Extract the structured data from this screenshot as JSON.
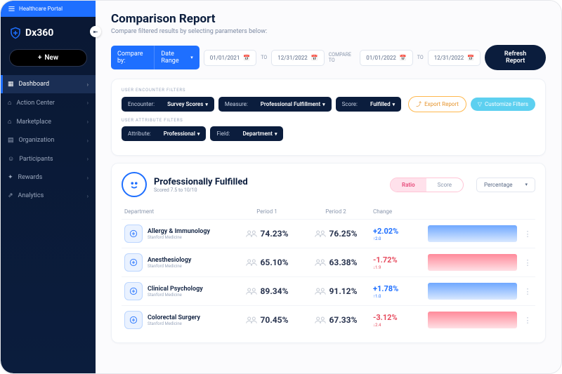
{
  "topBanner": "Healthcare Portal",
  "brand": "Dx360",
  "newBtn": "New",
  "nav": [
    {
      "icon": "grid",
      "label": "Dashboard",
      "active": true
    },
    {
      "icon": "bell",
      "label": "Action Center"
    },
    {
      "icon": "bag",
      "label": "Marketplace"
    },
    {
      "icon": "building",
      "label": "Organization"
    },
    {
      "icon": "users",
      "label": "Participants"
    },
    {
      "icon": "gift",
      "label": "Rewards"
    },
    {
      "icon": "chart",
      "label": "Analytics"
    }
  ],
  "page": {
    "title": "Comparison Report",
    "subtitle": "Compare filtered results by selecting parameters below:"
  },
  "compare": {
    "byLabel": "Compare by:",
    "byValue": "Date Range",
    "fromA": "01/01/2021",
    "toA": "12/31/2022",
    "toLabel": "TO",
    "compareToLabel": "COMPARE TO",
    "fromB": "01/01/2022",
    "toB": "12/31/2022",
    "refresh": "Refresh Report"
  },
  "filters": {
    "encLabel": "USER ENCOUNTER FILTERS",
    "enc": [
      {
        "l": "Encounter:",
        "v": "Survey Scores"
      },
      {
        "l": "Measure:",
        "v": "Professional Fulfillment"
      },
      {
        "l": "Score:",
        "v": "Fulfilled"
      }
    ],
    "export": "Export Report",
    "customize": "Customize Filters",
    "attrLabel": "USER ATTRIBUTE FILTERS",
    "attr": [
      {
        "l": "Attribute:",
        "v": "Professional"
      },
      {
        "l": "Field:",
        "v": "Department"
      }
    ]
  },
  "metric": {
    "title": "Professionally Fulfilled",
    "sub": "Scored 7.5 to 10/10",
    "toggle": {
      "a": "Ratio",
      "b": "Score"
    },
    "selector": "Percentage"
  },
  "table": {
    "headers": {
      "dept": "Department",
      "p1": "Period 1",
      "p2": "Period 2",
      "chg": "Change"
    },
    "rows": [
      {
        "name": "Allergy & Immunology",
        "org": "Stanford Medicine",
        "p1": "74.23%",
        "p2": "76.25%",
        "chg": "+2.02%",
        "delta": "↑2.0",
        "dir": "pos"
      },
      {
        "name": "Anesthesiology",
        "org": "Stanford Medicine",
        "p1": "65.10%",
        "p2": "63.38%",
        "chg": "-1.72%",
        "delta": "↓1.9",
        "dir": "neg"
      },
      {
        "name": "Clinical Psychology",
        "org": "Stanford Medicine",
        "p1": "89.34%",
        "p2": "91.12%",
        "chg": "+1.78%",
        "delta": "↑1.0",
        "dir": "pos"
      },
      {
        "name": "Colorectal Surgery",
        "org": "Stanford Medicine",
        "p1": "70.45%",
        "p2": "67.33%",
        "chg": "-3.12%",
        "delta": "↓2.4",
        "dir": "neg"
      }
    ]
  }
}
